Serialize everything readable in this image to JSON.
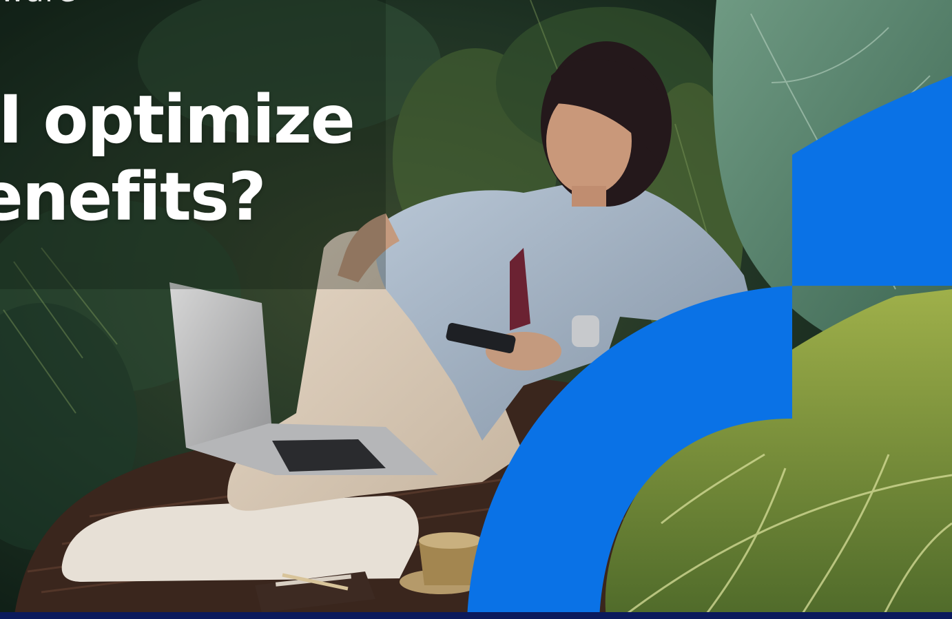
{
  "brand": {
    "partial_text": "ware",
    "blue": "#0a72e6",
    "bar": "#0b1a5c"
  },
  "headline": {
    "line1": "o I optimize",
    "line2": "benefits?"
  },
  "scene": {
    "subject": "woman-with-phone-and-laptop",
    "icons": [
      "laptop-icon",
      "phone-icon",
      "coffee-cup-icon",
      "notebook-icon",
      "pen-icon"
    ]
  }
}
